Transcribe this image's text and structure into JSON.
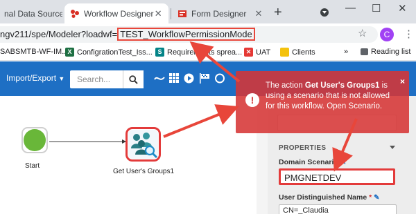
{
  "browser": {
    "tabs": [
      {
        "label": "nal Data Source:",
        "active": false
      },
      {
        "label": "Workflow Designer",
        "active": true
      },
      {
        "label": "Form Designer",
        "active": false
      }
    ],
    "new_tab": "+",
    "window_controls": {
      "minimize": "—",
      "maximize": "☐",
      "close": "✕"
    },
    "url_prefix": "ngv211/spe/Modeler?loadwf=",
    "url_highlight": "TEST_WorkflowPermissionMode",
    "profile_initial": "C",
    "bookmarks": [
      {
        "label": "SABSMTB-WF-IM...",
        "icon": "page-icon",
        "color": "#7c4dff"
      },
      {
        "label": "ConfigrationTest_Iss...",
        "icon": "excel-icon",
        "color": "#1d6f42"
      },
      {
        "label": "Requirements sprea...",
        "icon": "sharepoint-icon",
        "color": "#038387"
      },
      {
        "label": "UAT",
        "icon": "uat-icon",
        "color": "#e53935"
      },
      {
        "label": "Clients",
        "icon": "folder-icon",
        "color": "#f4c20d"
      }
    ],
    "bookmarks_more": "»",
    "reading_list": "Reading list"
  },
  "toolbar": {
    "import_export": "Import/Export",
    "search_placeholder": "Search..."
  },
  "canvas": {
    "start_label": "Start",
    "activity_label": "Get User's Groups1"
  },
  "toast": {
    "prefix": "The action ",
    "action_name": "Get User's Groups1",
    "suffix": " is using a scenario that is not allowed for this workflow. Open Scenario.",
    "close": "×",
    "color": "#d63636"
  },
  "panel": {
    "properties_header": "PROPERTIES",
    "domain_scenario_label": "Domain Scenario",
    "domain_scenario_value": "PMGNETDEV",
    "user_dn_label": "User Distinguished Name",
    "required_marker": "*",
    "user_dn_value": "CN=_Claudia"
  },
  "colors": {
    "toolbar": "#1e6fc4",
    "highlight": "#e33b3b",
    "start_node": "#69b739"
  }
}
